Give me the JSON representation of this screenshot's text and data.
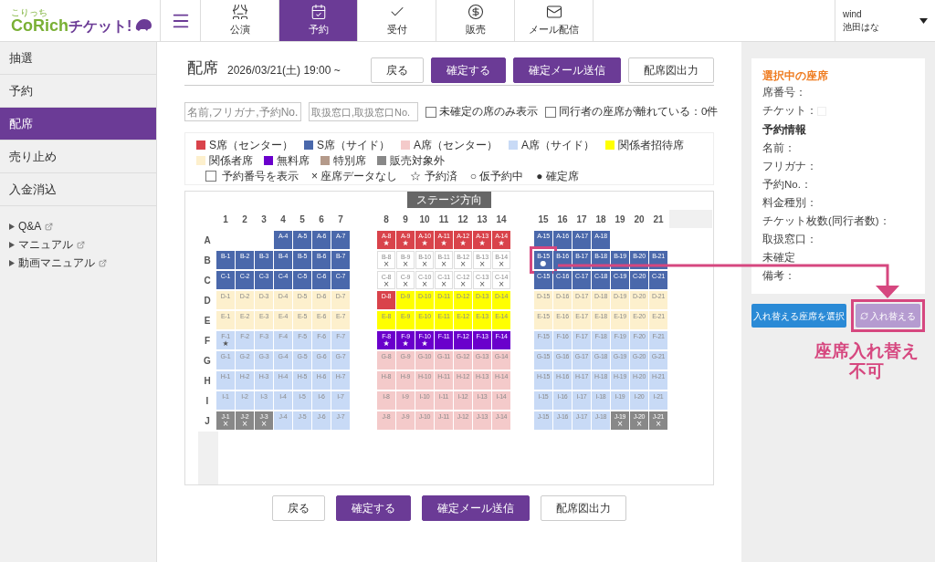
{
  "logo": {
    "ruby": "こりっち",
    "main": "CoRich",
    "sub": "チケット!"
  },
  "nav_tabs": [
    {
      "label": "公演",
      "selected": false
    },
    {
      "label": "予約",
      "selected": true
    },
    {
      "label": "受付",
      "selected": false
    },
    {
      "label": "販売",
      "selected": false
    },
    {
      "label": "メール配信",
      "selected": false
    }
  ],
  "user": {
    "account": "wind",
    "name": "池田はな"
  },
  "sidebar": {
    "items": [
      {
        "label": "抽選",
        "selected": false
      },
      {
        "label": "予約",
        "selected": false
      },
      {
        "label": "配席",
        "selected": true
      },
      {
        "label": "売り止め",
        "selected": false
      },
      {
        "label": "入金消込",
        "selected": false
      }
    ],
    "links": [
      "Q&A",
      "マニュアル",
      "動画マニュアル"
    ]
  },
  "page": {
    "title": "配席",
    "date": "2026/03/21(土) 19:00 ~",
    "buttons": [
      {
        "label": "戻る",
        "kind": "secondary"
      },
      {
        "label": "確定する",
        "kind": "primary"
      },
      {
        "label": "確定メール送信",
        "kind": "primary"
      },
      {
        "label": "配席図出力",
        "kind": "secondary"
      }
    ]
  },
  "filters": {
    "search_fields": [
      {
        "placeholder": "名前,フリガナ,予約No."
      },
      {
        "placeholder": "取扱窓口,取扱窓口No."
      }
    ],
    "checkboxes": [
      {
        "label": "未確定の席のみ表示",
        "checked": false
      },
      {
        "label": "同行者の座席が離れている：0件",
        "checked": false
      }
    ]
  },
  "legend": {
    "categories": [
      {
        "label": "S席（センター）",
        "kind": "s_center",
        "color": "#d9434b"
      },
      {
        "label": "S席（サイド）",
        "kind": "s_side",
        "color": "#4a68ab"
      },
      {
        "label": "A席（センター）",
        "kind": "a_center",
        "color": "#f4caca"
      },
      {
        "label": "A席（サイド）",
        "kind": "a_side",
        "color": "#c8daf6"
      },
      {
        "label": "関係者招待席",
        "kind": "guest",
        "color": "#ffff00"
      },
      {
        "label": "関係者席",
        "kind": "staff",
        "color": "#fdf0cd"
      },
      {
        "label": "無料席",
        "kind": "free",
        "color": "#6a00cc"
      },
      {
        "label": "特別席",
        "kind": "special",
        "color": "#b49a8a"
      },
      {
        "label": "販売対象外",
        "kind": "unavailable",
        "color": "#888888"
      }
    ],
    "display_option": {
      "label": "予約番号を表示",
      "checked": false
    },
    "symbols": [
      {
        "label": "× 座席データなし"
      },
      {
        "label": "☆ 予約済"
      },
      {
        "label": "○ 仮予約中"
      },
      {
        "label": "● 確定席"
      }
    ]
  },
  "seat_map": {
    "stage_label": "ステージ方向",
    "column_blocks": [
      [
        "1",
        "2",
        "3",
        "4",
        "5",
        "6",
        "7"
      ],
      [
        "8",
        "9",
        "10",
        "11",
        "12",
        "13",
        "14"
      ],
      [
        "15",
        "16",
        "17",
        "18",
        "19",
        "20",
        "21"
      ]
    ],
    "rows": [
      {
        "label": "A",
        "blocks": [
          [
            {
              "kind": "blank"
            },
            {
              "kind": "blank"
            },
            {
              "kind": "blank"
            },
            {
              "label": "A-4",
              "kind": "s_side",
              "selected": false
            },
            {
              "label": "A-5",
              "kind": "s_side",
              "selected": false
            },
            {
              "label": "A-6",
              "kind": "s_side",
              "selected": false
            },
            {
              "label": "A-7",
              "kind": "s_side",
              "selected": false
            }
          ],
          [
            {
              "label": "A-8",
              "kind": "s_center",
              "mark": "★",
              "selected": false
            },
            {
              "label": "A-9",
              "kind": "s_center",
              "mark": "★",
              "selected": false
            },
            {
              "label": "A-10",
              "kind": "s_center",
              "mark": "★",
              "selected": false
            },
            {
              "label": "A-11",
              "kind": "s_center",
              "mark": "★",
              "selected": false
            },
            {
              "label": "A-12",
              "kind": "s_center",
              "mark": "★",
              "selected": false
            },
            {
              "label": "A-13",
              "kind": "s_center",
              "mark": "★",
              "selected": false
            },
            {
              "label": "A-14",
              "kind": "s_center",
              "mark": "★",
              "selected": false
            }
          ],
          [
            {
              "label": "A-15",
              "kind": "s_side",
              "selected": false
            },
            {
              "label": "A-16",
              "kind": "s_side",
              "selected": false
            },
            {
              "label": "A-17",
              "kind": "s_side",
              "selected": false
            },
            {
              "label": "A-18",
              "kind": "s_side",
              "selected": false
            },
            {
              "kind": "blank"
            },
            {
              "kind": "blank"
            },
            {
              "kind": "blank"
            }
          ]
        ]
      },
      {
        "label": "B",
        "blocks": [
          [
            {
              "label": "B-1",
              "kind": "s_side",
              "selected": false
            },
            {
              "label": "B-2",
              "kind": "s_side",
              "selected": false
            },
            {
              "label": "B-3",
              "kind": "s_side",
              "selected": false
            },
            {
              "label": "B-4",
              "kind": "s_side",
              "selected": false
            },
            {
              "label": "B-5",
              "kind": "s_side",
              "selected": false
            },
            {
              "label": "B-6",
              "kind": "s_side",
              "selected": false
            },
            {
              "label": "B-7",
              "kind": "s_side",
              "selected": false
            }
          ],
          [
            {
              "label": "B-8",
              "kind": "no_data",
              "mark": "×",
              "selected": false
            },
            {
              "label": "B-9",
              "kind": "no_data",
              "mark": "×",
              "selected": false
            },
            {
              "label": "B-10",
              "kind": "no_data",
              "mark": "×",
              "selected": false
            },
            {
              "label": "B-11",
              "kind": "no_data",
              "mark": "×",
              "selected": false
            },
            {
              "label": "B-12",
              "kind": "no_data",
              "mark": "×",
              "selected": false
            },
            {
              "label": "B-13",
              "kind": "no_data",
              "mark": "×",
              "selected": false
            },
            {
              "label": "B-14",
              "kind": "no_data",
              "mark": "×",
              "selected": false
            }
          ],
          [
            {
              "label": "B-15",
              "kind": "s_side",
              "mark": "●",
              "selected": true
            },
            {
              "label": "B-16",
              "kind": "s_side",
              "selected": false
            },
            {
              "label": "B-17",
              "kind": "s_side",
              "selected": false
            },
            {
              "label": "B-18",
              "kind": "s_side",
              "selected": false
            },
            {
              "label": "B-19",
              "kind": "s_side",
              "selected": false
            },
            {
              "label": "B-20",
              "kind": "s_side",
              "selected": false
            },
            {
              "label": "B-21",
              "kind": "s_side",
              "selected": false
            }
          ]
        ]
      },
      {
        "label": "C",
        "blocks": [
          [
            {
              "label": "C-1",
              "kind": "s_side",
              "selected": false
            },
            {
              "label": "C-2",
              "kind": "s_side",
              "selected": false
            },
            {
              "label": "C-3",
              "kind": "s_side",
              "selected": false
            },
            {
              "label": "C-4",
              "kind": "s_side",
              "selected": false
            },
            {
              "label": "C-5",
              "kind": "s_side",
              "selected": false
            },
            {
              "label": "C-6",
              "kind": "s_side",
              "selected": false
            },
            {
              "label": "C-7",
              "kind": "s_side",
              "selected": false
            }
          ],
          [
            {
              "label": "C-8",
              "kind": "no_data",
              "mark": "×",
              "selected": false
            },
            {
              "label": "C-9",
              "kind": "no_data",
              "mark": "×",
              "selected": false
            },
            {
              "label": "C-10",
              "kind": "no_data",
              "mark": "×",
              "selected": false
            },
            {
              "label": "C-11",
              "kind": "no_data",
              "mark": "×",
              "selected": false
            },
            {
              "label": "C-12",
              "kind": "no_data",
              "mark": "×",
              "selected": false
            },
            {
              "label": "C-13",
              "kind": "no_data",
              "mark": "×",
              "selected": false
            },
            {
              "label": "C-14",
              "kind": "no_data",
              "mark": "×",
              "selected": false
            }
          ],
          [
            {
              "label": "C-15",
              "kind": "s_side",
              "selected": false
            },
            {
              "label": "C-16",
              "kind": "s_side",
              "selected": false
            },
            {
              "label": "C-17",
              "kind": "s_side",
              "selected": false
            },
            {
              "label": "C-18",
              "kind": "s_side",
              "selected": false
            },
            {
              "label": "C-19",
              "kind": "s_side",
              "selected": false
            },
            {
              "label": "C-20",
              "kind": "s_side",
              "selected": false
            },
            {
              "label": "C-21",
              "kind": "s_side",
              "selected": false
            }
          ]
        ]
      },
      {
        "label": "D",
        "blocks": [
          [
            {
              "label": "D-1",
              "kind": "staff",
              "selected": false
            },
            {
              "label": "D-2",
              "kind": "staff",
              "selected": false
            },
            {
              "label": "D-3",
              "kind": "staff",
              "selected": false
            },
            {
              "label": "D-4",
              "kind": "staff",
              "selected": false
            },
            {
              "label": "D-5",
              "kind": "staff",
              "selected": false
            },
            {
              "label": "D-6",
              "kind": "staff",
              "selected": false
            },
            {
              "label": "D-7",
              "kind": "staff",
              "selected": false
            }
          ],
          [
            {
              "label": "D-8",
              "kind": "s_center",
              "selected": false
            },
            {
              "label": "D-9",
              "kind": "guest",
              "selected": false
            },
            {
              "label": "D-10",
              "kind": "guest",
              "selected": false
            },
            {
              "label": "D-11",
              "kind": "guest",
              "selected": false
            },
            {
              "label": "D-12",
              "kind": "guest",
              "selected": false
            },
            {
              "label": "D-13",
              "kind": "guest",
              "selected": false
            },
            {
              "label": "D-14",
              "kind": "guest",
              "selected": false
            }
          ],
          [
            {
              "label": "D-15",
              "kind": "staff",
              "selected": false
            },
            {
              "label": "D-16",
              "kind": "staff",
              "selected": false
            },
            {
              "label": "D-17",
              "kind": "staff",
              "selected": false
            },
            {
              "label": "D-18",
              "kind": "staff",
              "selected": false
            },
            {
              "label": "D-19",
              "kind": "staff",
              "selected": false
            },
            {
              "label": "D-20",
              "kind": "staff",
              "selected": false
            },
            {
              "label": "D-21",
              "kind": "staff",
              "selected": false
            }
          ]
        ]
      },
      {
        "label": "E",
        "blocks": [
          [
            {
              "label": "E-1",
              "kind": "staff",
              "selected": false
            },
            {
              "label": "E-2",
              "kind": "staff",
              "selected": false
            },
            {
              "label": "E-3",
              "kind": "staff",
              "selected": false
            },
            {
              "label": "E-4",
              "kind": "staff",
              "selected": false
            },
            {
              "label": "E-5",
              "kind": "staff",
              "selected": false
            },
            {
              "label": "E-6",
              "kind": "staff",
              "selected": false
            },
            {
              "label": "E-7",
              "kind": "staff",
              "selected": false
            }
          ],
          [
            {
              "label": "E-8",
              "kind": "guest",
              "selected": false
            },
            {
              "label": "E-9",
              "kind": "guest",
              "selected": false
            },
            {
              "label": "E-10",
              "kind": "guest",
              "selected": false
            },
            {
              "label": "E-11",
              "kind": "guest",
              "selected": false
            },
            {
              "label": "E-12",
              "kind": "guest",
              "selected": false
            },
            {
              "label": "E-13",
              "kind": "guest",
              "selected": false
            },
            {
              "label": "E-14",
              "kind": "guest",
              "selected": false
            }
          ],
          [
            {
              "label": "E-15",
              "kind": "staff",
              "selected": false
            },
            {
              "label": "E-16",
              "kind": "staff",
              "selected": false
            },
            {
              "label": "E-17",
              "kind": "staff",
              "selected": false
            },
            {
              "label": "E-18",
              "kind": "staff",
              "selected": false
            },
            {
              "label": "E-19",
              "kind": "staff",
              "selected": false
            },
            {
              "label": "E-20",
              "kind": "staff",
              "selected": false
            },
            {
              "label": "E-21",
              "kind": "staff",
              "selected": false
            }
          ]
        ]
      },
      {
        "label": "F",
        "blocks": [
          [
            {
              "label": "F-1",
              "kind": "a_side",
              "mark": "★",
              "selected": false
            },
            {
              "label": "F-2",
              "kind": "a_side",
              "selected": false
            },
            {
              "label": "F-3",
              "kind": "a_side",
              "selected": false
            },
            {
              "label": "F-4",
              "kind": "a_side",
              "selected": false
            },
            {
              "label": "F-5",
              "kind": "a_side",
              "selected": false
            },
            {
              "label": "F-6",
              "kind": "a_side",
              "selected": false
            },
            {
              "label": "F-7",
              "kind": "a_side",
              "selected": false
            }
          ],
          [
            {
              "label": "F-8",
              "kind": "free",
              "mark": "★",
              "selected": false
            },
            {
              "label": "F-9",
              "kind": "free",
              "mark": "★",
              "selected": false
            },
            {
              "label": "F-10",
              "kind": "free",
              "mark": "★",
              "selected": false
            },
            {
              "label": "F-11",
              "kind": "free",
              "selected": false
            },
            {
              "label": "F-12",
              "kind": "free",
              "selected": false
            },
            {
              "label": "F-13",
              "kind": "free",
              "selected": false
            },
            {
              "label": "F-14",
              "kind": "free",
              "selected": false
            }
          ],
          [
            {
              "label": "F-15",
              "kind": "a_side",
              "selected": false
            },
            {
              "label": "F-16",
              "kind": "a_side",
              "selected": false
            },
            {
              "label": "F-17",
              "kind": "a_side",
              "selected": false
            },
            {
              "label": "F-18",
              "kind": "a_side",
              "selected": false
            },
            {
              "label": "F-19",
              "kind": "a_side",
              "selected": false
            },
            {
              "label": "F-20",
              "kind": "a_side",
              "selected": false
            },
            {
              "label": "F-21",
              "kind": "a_side",
              "selected": false
            }
          ]
        ]
      },
      {
        "label": "G",
        "blocks": [
          [
            {
              "label": "G-1",
              "kind": "a_side",
              "selected": false
            },
            {
              "label": "G-2",
              "kind": "a_side",
              "selected": false
            },
            {
              "label": "G-3",
              "kind": "a_side",
              "selected": false
            },
            {
              "label": "G-4",
              "kind": "a_side",
              "selected": false
            },
            {
              "label": "G-5",
              "kind": "a_side",
              "selected": false
            },
            {
              "label": "G-6",
              "kind": "a_side",
              "selected": false
            },
            {
              "label": "G-7",
              "kind": "a_side",
              "selected": false
            }
          ],
          [
            {
              "label": "G-8",
              "kind": "a_center",
              "selected": false
            },
            {
              "label": "G-9",
              "kind": "a_center",
              "selected": false
            },
            {
              "label": "G-10",
              "kind": "a_center",
              "selected": false
            },
            {
              "label": "G-11",
              "kind": "a_center",
              "selected": false
            },
            {
              "label": "G-12",
              "kind": "a_center",
              "selected": false
            },
            {
              "label": "G-13",
              "kind": "a_center",
              "selected": false
            },
            {
              "label": "G-14",
              "kind": "a_center",
              "selected": false
            }
          ],
          [
            {
              "label": "G-15",
              "kind": "a_side",
              "selected": false
            },
            {
              "label": "G-16",
              "kind": "a_side",
              "selected": false
            },
            {
              "label": "G-17",
              "kind": "a_side",
              "selected": false
            },
            {
              "label": "G-18",
              "kind": "a_side",
              "selected": false
            },
            {
              "label": "G-19",
              "kind": "a_side",
              "selected": false
            },
            {
              "label": "G-20",
              "kind": "a_side",
              "selected": false
            },
            {
              "label": "G-21",
              "kind": "a_side",
              "selected": false
            }
          ]
        ]
      },
      {
        "label": "H",
        "blocks": [
          [
            {
              "label": "H-1",
              "kind": "a_side",
              "selected": false
            },
            {
              "label": "H-2",
              "kind": "a_side",
              "selected": false
            },
            {
              "label": "H-3",
              "kind": "a_side",
              "selected": false
            },
            {
              "label": "H-4",
              "kind": "a_side",
              "selected": false
            },
            {
              "label": "H-5",
              "kind": "a_side",
              "selected": false
            },
            {
              "label": "H-6",
              "kind": "a_side",
              "selected": false
            },
            {
              "label": "H-7",
              "kind": "a_side",
              "selected": false
            }
          ],
          [
            {
              "label": "H-8",
              "kind": "a_center",
              "selected": false
            },
            {
              "label": "H-9",
              "kind": "a_center",
              "selected": false
            },
            {
              "label": "H-10",
              "kind": "a_center",
              "selected": false
            },
            {
              "label": "H-11",
              "kind": "a_center",
              "selected": false
            },
            {
              "label": "H-12",
              "kind": "a_center",
              "selected": false
            },
            {
              "label": "H-13",
              "kind": "a_center",
              "selected": false
            },
            {
              "label": "H-14",
              "kind": "a_center",
              "selected": false
            }
          ],
          [
            {
              "label": "H-15",
              "kind": "a_side",
              "selected": false
            },
            {
              "label": "H-16",
              "kind": "a_side",
              "selected": false
            },
            {
              "label": "H-17",
              "kind": "a_side",
              "selected": false
            },
            {
              "label": "H-18",
              "kind": "a_side",
              "selected": false
            },
            {
              "label": "H-19",
              "kind": "a_side",
              "selected": false
            },
            {
              "label": "H-20",
              "kind": "a_side",
              "selected": false
            },
            {
              "label": "H-21",
              "kind": "a_side",
              "selected": false
            }
          ]
        ]
      },
      {
        "label": "I",
        "blocks": [
          [
            {
              "label": "I-1",
              "kind": "a_side",
              "selected": false
            },
            {
              "label": "I-2",
              "kind": "a_side",
              "selected": false
            },
            {
              "label": "I-3",
              "kind": "a_side",
              "selected": false
            },
            {
              "label": "I-4",
              "kind": "a_side",
              "selected": false
            },
            {
              "label": "I-5",
              "kind": "a_side",
              "selected": false
            },
            {
              "label": "I-6",
              "kind": "a_side",
              "selected": false
            },
            {
              "label": "I-7",
              "kind": "a_side",
              "selected": false
            }
          ],
          [
            {
              "label": "I-8",
              "kind": "a_center",
              "selected": false
            },
            {
              "label": "I-9",
              "kind": "a_center",
              "selected": false
            },
            {
              "label": "I-10",
              "kind": "a_center",
              "selected": false
            },
            {
              "label": "I-11",
              "kind": "a_center",
              "selected": false
            },
            {
              "label": "I-12",
              "kind": "a_center",
              "selected": false
            },
            {
              "label": "I-13",
              "kind": "a_center",
              "selected": false
            },
            {
              "label": "I-14",
              "kind": "a_center",
              "selected": false
            }
          ],
          [
            {
              "label": "I-15",
              "kind": "a_side",
              "selected": false
            },
            {
              "label": "I-16",
              "kind": "a_side",
              "selected": false
            },
            {
              "label": "I-17",
              "kind": "a_side",
              "selected": false
            },
            {
              "label": "I-18",
              "kind": "a_side",
              "selected": false
            },
            {
              "label": "I-19",
              "kind": "a_side",
              "selected": false
            },
            {
              "label": "I-20",
              "kind": "a_side",
              "selected": false
            },
            {
              "label": "I-21",
              "kind": "a_side",
              "selected": false
            }
          ]
        ]
      },
      {
        "label": "J",
        "blocks": [
          [
            {
              "label": "J-1",
              "kind": "unavailable",
              "mark": "×",
              "selected": false
            },
            {
              "label": "J-2",
              "kind": "unavailable",
              "mark": "×",
              "selected": false
            },
            {
              "label": "J-3",
              "kind": "unavailable",
              "mark": "×",
              "selected": false
            },
            {
              "label": "J-4",
              "kind": "a_side",
              "selected": false
            },
            {
              "label": "J-5",
              "kind": "a_side",
              "selected": false
            },
            {
              "label": "J-6",
              "kind": "a_side",
              "selected": false
            },
            {
              "label": "J-7",
              "kind": "a_side",
              "selected": false
            }
          ],
          [
            {
              "label": "J-8",
              "kind": "a_center",
              "selected": false
            },
            {
              "label": "J-9",
              "kind": "a_center",
              "selected": false
            },
            {
              "label": "J-10",
              "kind": "a_center",
              "selected": false
            },
            {
              "label": "J-11",
              "kind": "a_center",
              "selected": false
            },
            {
              "label": "J-12",
              "kind": "a_center",
              "selected": false
            },
            {
              "label": "J-13",
              "kind": "a_center",
              "selected": false
            },
            {
              "label": "J-14",
              "kind": "a_center",
              "selected": false
            }
          ],
          [
            {
              "label": "J-15",
              "kind": "a_side",
              "selected": false
            },
            {
              "label": "J-16",
              "kind": "a_side",
              "selected": false
            },
            {
              "label": "J-17",
              "kind": "a_side",
              "selected": false
            },
            {
              "label": "J-18",
              "kind": "a_side",
              "selected": false
            },
            {
              "label": "J-19",
              "kind": "unavailable",
              "mark": "×",
              "selected": false
            },
            {
              "label": "J-20",
              "kind": "unavailable",
              "mark": "×",
              "selected": false
            },
            {
              "label": "J-21",
              "kind": "unavailable",
              "mark": "×",
              "selected": false
            }
          ]
        ]
      }
    ]
  },
  "bottom_buttons": [
    {
      "label": "戻る",
      "kind": "secondary"
    },
    {
      "label": "確定する",
      "kind": "primary"
    },
    {
      "label": "確定メール送信",
      "kind": "primary"
    },
    {
      "label": "配席図出力",
      "kind": "secondary"
    }
  ],
  "selected_seat_panel": {
    "title": "選択中の座席",
    "seat_fields": [
      {
        "label": "席番号：",
        "kind": "text"
      },
      {
        "label": "チケット：",
        "kind": "swatch"
      }
    ],
    "reservation_title": "予約情報",
    "reservation_fields": [
      "名前：",
      "フリガナ：",
      "予約No.：",
      "料金種別：",
      "チケット枚数(同行者数)：",
      "取扱窓口：",
      "未確定",
      "備考："
    ],
    "buttons": [
      {
        "label": "入れ替える座席を選択",
        "kind": "select",
        "disabled": false
      },
      {
        "label": "入れ替える",
        "kind": "swap",
        "disabled": true
      }
    ]
  },
  "callout": {
    "note": "座席入れ替え不可"
  }
}
